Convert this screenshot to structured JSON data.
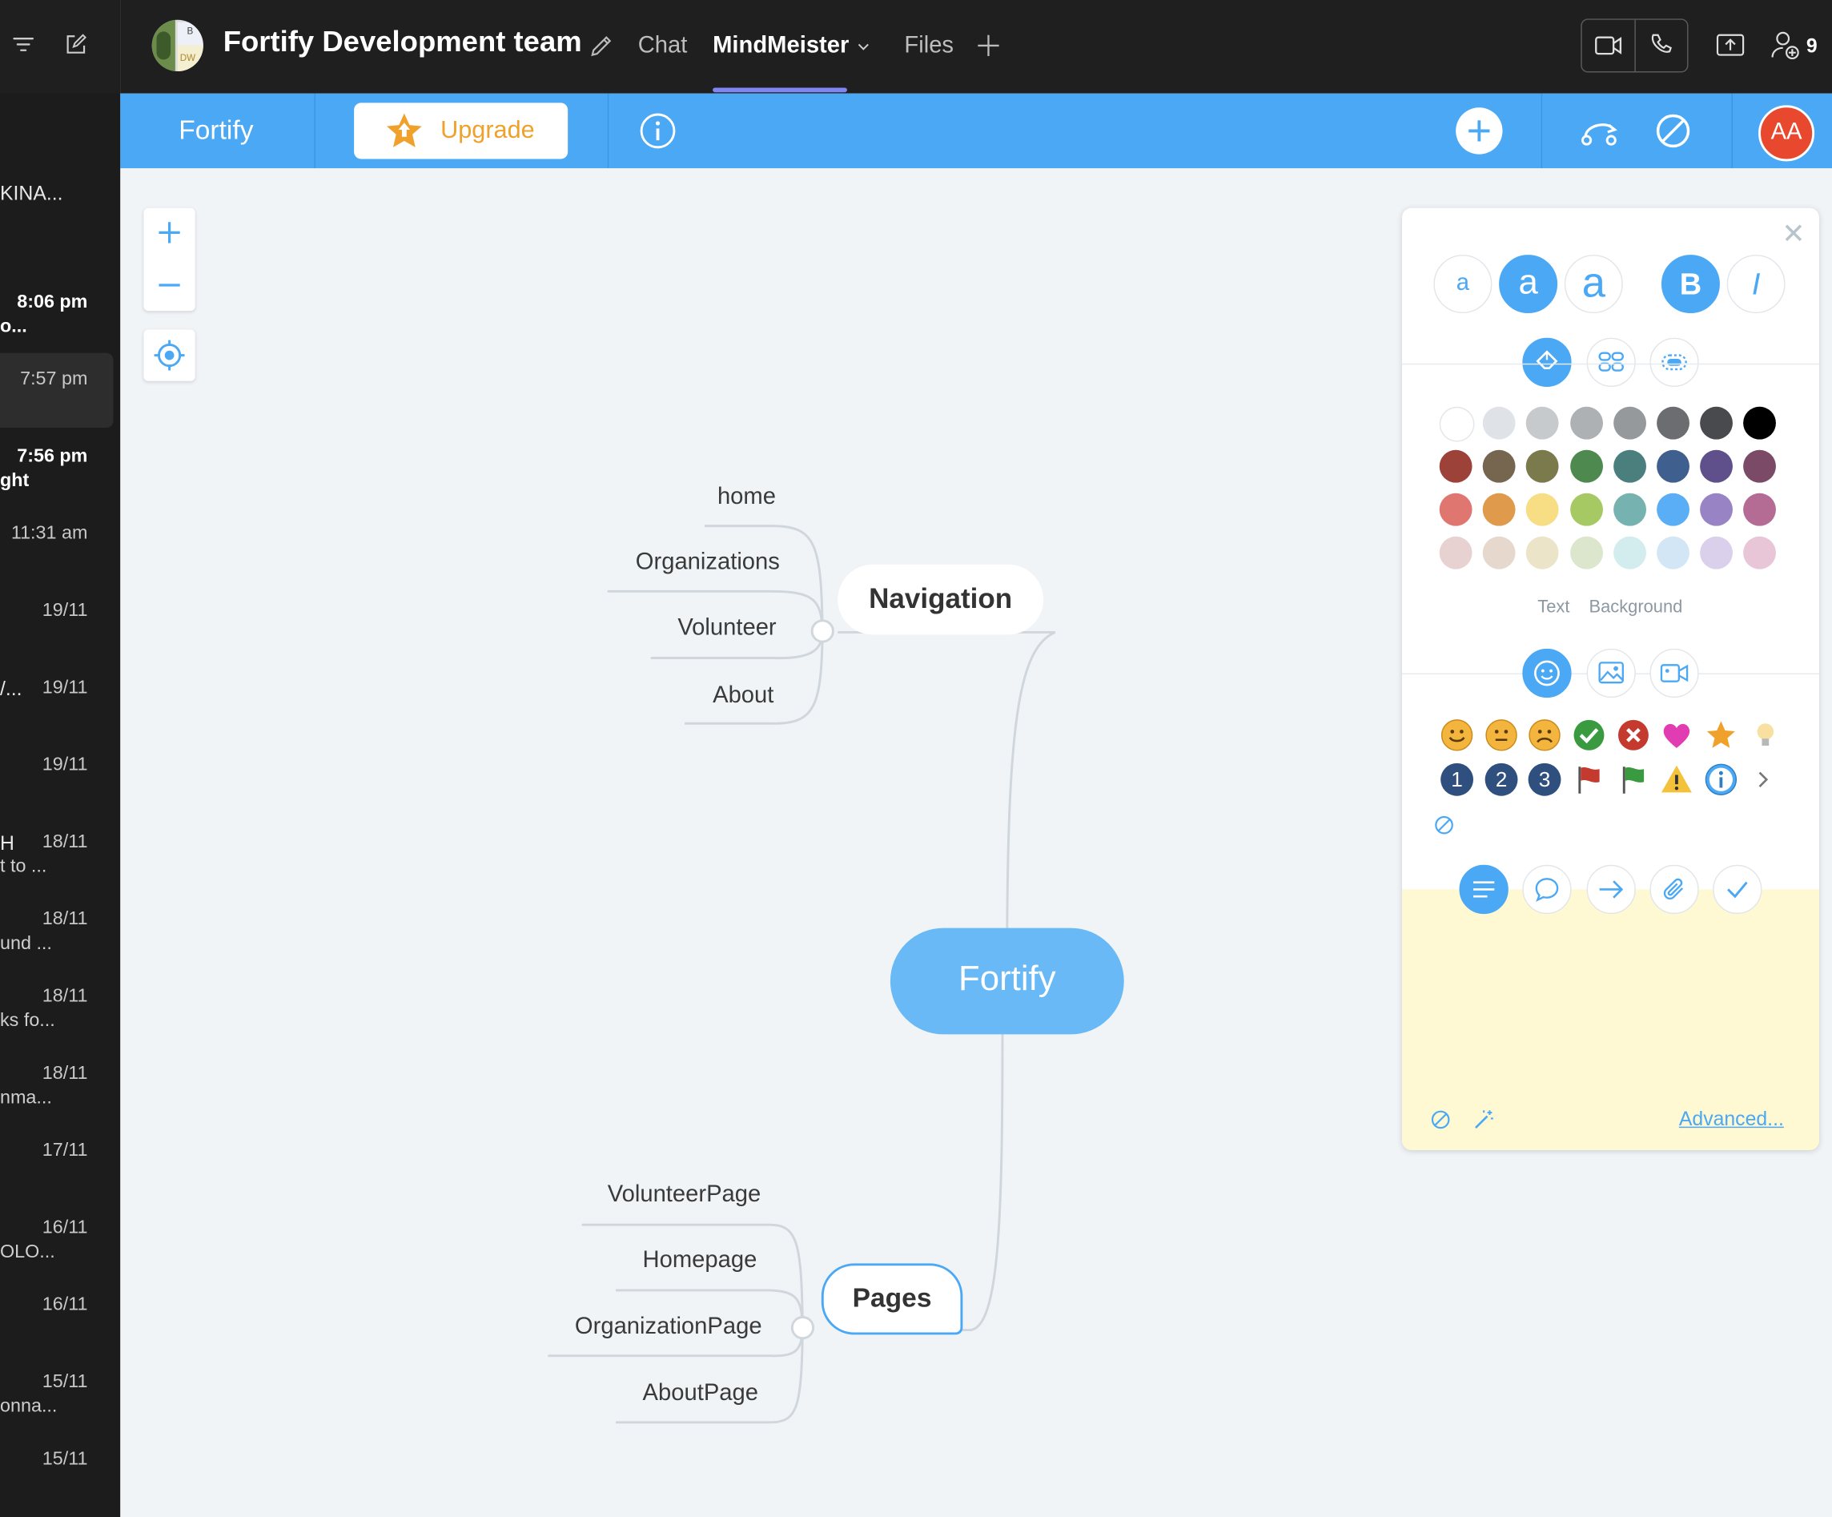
{
  "sidebar": {
    "chats": [
      {
        "name": "KINA...",
        "time": "",
        "sub": ""
      },
      {
        "name": "",
        "time": "8:06 pm",
        "sub": "o...",
        "bold": true
      },
      {
        "name": "",
        "time": "7:57 pm",
        "sub": "",
        "selected": true
      },
      {
        "name": "",
        "time": "7:56 pm",
        "sub": "ght",
        "bold": true
      },
      {
        "name": "",
        "time": "11:31 am",
        "sub": ""
      },
      {
        "name": "",
        "time": "19/11",
        "sub": ""
      },
      {
        "name": "/...",
        "time": "19/11",
        "sub": ""
      },
      {
        "name": "",
        "time": "19/11",
        "sub": ""
      },
      {
        "name": "H",
        "time": "18/11",
        "sub": "t to ..."
      },
      {
        "name": "",
        "time": "18/11",
        "sub": "und ..."
      },
      {
        "name": "",
        "time": "18/11",
        "sub": "ks fo..."
      },
      {
        "name": "",
        "time": "18/11",
        "sub": "nma..."
      },
      {
        "name": "",
        "time": "17/11",
        "sub": ""
      },
      {
        "name": "",
        "time": "16/11",
        "sub": "OLO..."
      },
      {
        "name": "",
        "time": "16/11",
        "sub": ""
      },
      {
        "name": "",
        "time": "15/11",
        "sub": "onna..."
      },
      {
        "name": "",
        "time": "15/11",
        "sub": ""
      }
    ]
  },
  "header": {
    "avatar_text_top": "B",
    "avatar_text_bottom": "DW",
    "team_title": "Fortify Development team",
    "tabs": [
      {
        "label": "Chat",
        "active": false
      },
      {
        "label": "MindMeister",
        "active": true
      },
      {
        "label": "Files",
        "active": false
      }
    ],
    "participants_count": "9"
  },
  "mm_toolbar": {
    "map_title": "Fortify",
    "upgrade_label": "Upgrade",
    "user_initials": "AA",
    "accent_color": "#4ba8f5",
    "upgrade_color": "#f0a12b",
    "user_color": "#e8492e"
  },
  "mindmap": {
    "root": "Fortify",
    "navigation": {
      "label": "Navigation",
      "children": [
        "home",
        "Organizations",
        "Volunteer",
        "About"
      ]
    },
    "pages": {
      "label": "Pages",
      "children": [
        "VolunteerPage",
        "Homepage",
        "OrganizationPage",
        "AboutPage"
      ]
    }
  },
  "format_panel": {
    "font_sizes": [
      "a",
      "a",
      "a"
    ],
    "bold_label": "B",
    "italic_label": "I",
    "palette": [
      [
        "#ffffff",
        "#dfe3e7",
        "#c7cacd",
        "#aeb1b4",
        "#96999c",
        "#6b6d70",
        "#484a4d",
        "#000000"
      ],
      [
        "#9c4238",
        "#76654f",
        "#7a7a4d",
        "#4e8a50",
        "#4a7f7e",
        "#3f5f8f",
        "#5f4f8a",
        "#7b4a67"
      ],
      [
        "#df7670",
        "#df9a4c",
        "#f7dd84",
        "#a6c964",
        "#75b2b0",
        "#5aaef5",
        "#9883c5",
        "#b46c94"
      ],
      [
        "#e8d2d1",
        "#e6d8cc",
        "#ece4c9",
        "#dbe6cc",
        "#d3ecee",
        "#d2e6f5",
        "#dad0ec",
        "#e8c6d8"
      ]
    ],
    "color_labels": [
      "Text",
      "Background"
    ],
    "icon_row1": [
      "smile-icon",
      "neutral-face-icon",
      "frown-icon",
      "check-green-icon",
      "cross-red-icon",
      "heart-icon",
      "star-icon",
      "bulb-icon"
    ],
    "icon_row2_numbers": [
      "1",
      "2",
      "3"
    ],
    "advanced_label": "Advanced..."
  }
}
